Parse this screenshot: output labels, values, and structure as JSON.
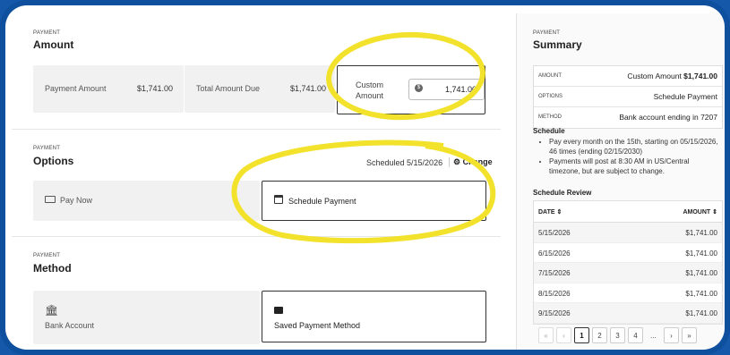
{
  "amount": {
    "eyebrow": "PAYMENT",
    "title": "Amount",
    "payment_amount_label": "Payment Amount",
    "payment_amount_value": "$1,741.00",
    "total_due_label": "Total Amount Due",
    "total_due_value": "$1,741.00",
    "custom_label_line1": "Custom",
    "custom_label_line2": "Amount",
    "custom_value": "1,741.00"
  },
  "options": {
    "eyebrow": "PAYMENT",
    "title": "Options",
    "scheduled_text": "Scheduled 5/15/2026",
    "change_label": "Change",
    "pay_now_label": "Pay Now",
    "schedule_label": "Schedule Payment"
  },
  "method": {
    "eyebrow": "PAYMENT",
    "title": "Method",
    "bank_label": "Bank Account",
    "saved_label": "Saved Payment Method"
  },
  "summary": {
    "eyebrow": "PAYMENT",
    "title": "Summary",
    "rows": [
      {
        "key": "AMOUNT",
        "value_prefix": "Custom Amount ",
        "value_strong": "$1,741.00"
      },
      {
        "key": "OPTIONS",
        "value_prefix": "Schedule Payment",
        "value_strong": ""
      },
      {
        "key": "METHOD",
        "value_prefix": "Bank account ending in 7207",
        "value_strong": ""
      }
    ],
    "schedule_title": "Schedule",
    "bullets": [
      "Pay every month on the 15th, starting on 05/15/2026, 46 times (ending 02/15/2030)",
      "Payments will post at 8:30 AM in US/Central timezone, but are subject to change."
    ],
    "review_title": "Schedule Review",
    "table_headers": {
      "date": "DATE",
      "amount": "AMOUNT"
    },
    "rows_review": [
      {
        "date": "5/15/2026",
        "amount": "$1,741.00"
      },
      {
        "date": "6/15/2026",
        "amount": "$1,741.00"
      },
      {
        "date": "7/15/2026",
        "amount": "$1,741.00"
      },
      {
        "date": "8/15/2026",
        "amount": "$1,741.00"
      },
      {
        "date": "9/15/2026",
        "amount": "$1,741.00"
      }
    ],
    "pager": [
      "1",
      "2",
      "3",
      "4",
      "..."
    ]
  },
  "colors": {
    "frame_blue": "#1557a8",
    "highlight_yellow": "#f3e22b",
    "tile_grey": "#f1f1f1"
  }
}
